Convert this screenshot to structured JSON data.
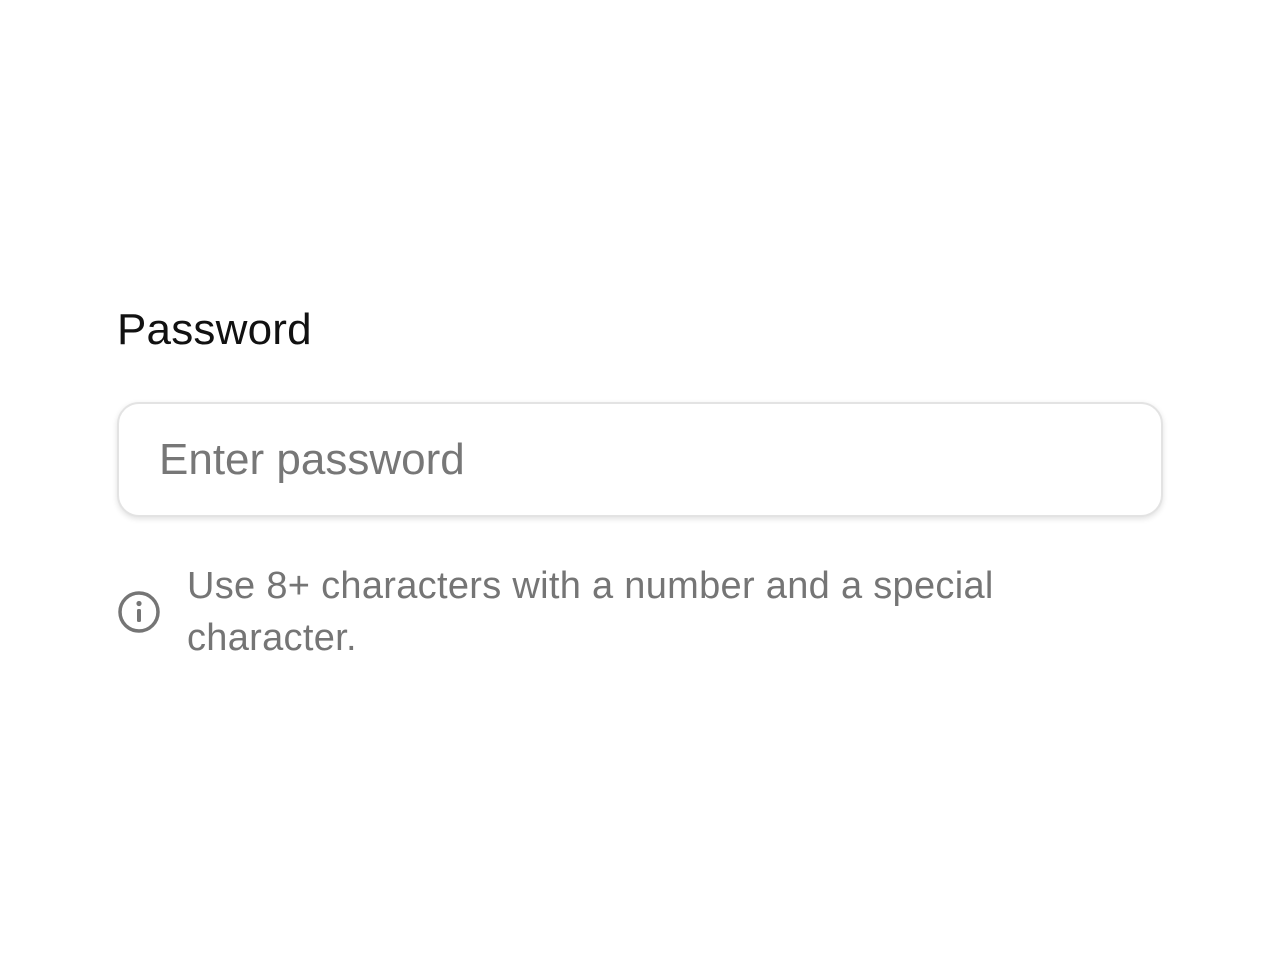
{
  "form": {
    "password_label": "Password",
    "password_input": {
      "value": "",
      "placeholder": "Enter password"
    },
    "helper": {
      "icon": "info-icon",
      "text": "Use 8+ characters with a number and a special character."
    }
  },
  "colors": {
    "label": "#111111",
    "placeholder": "#777777",
    "helper_text": "#757575",
    "input_border": "#e3e3e3"
  }
}
